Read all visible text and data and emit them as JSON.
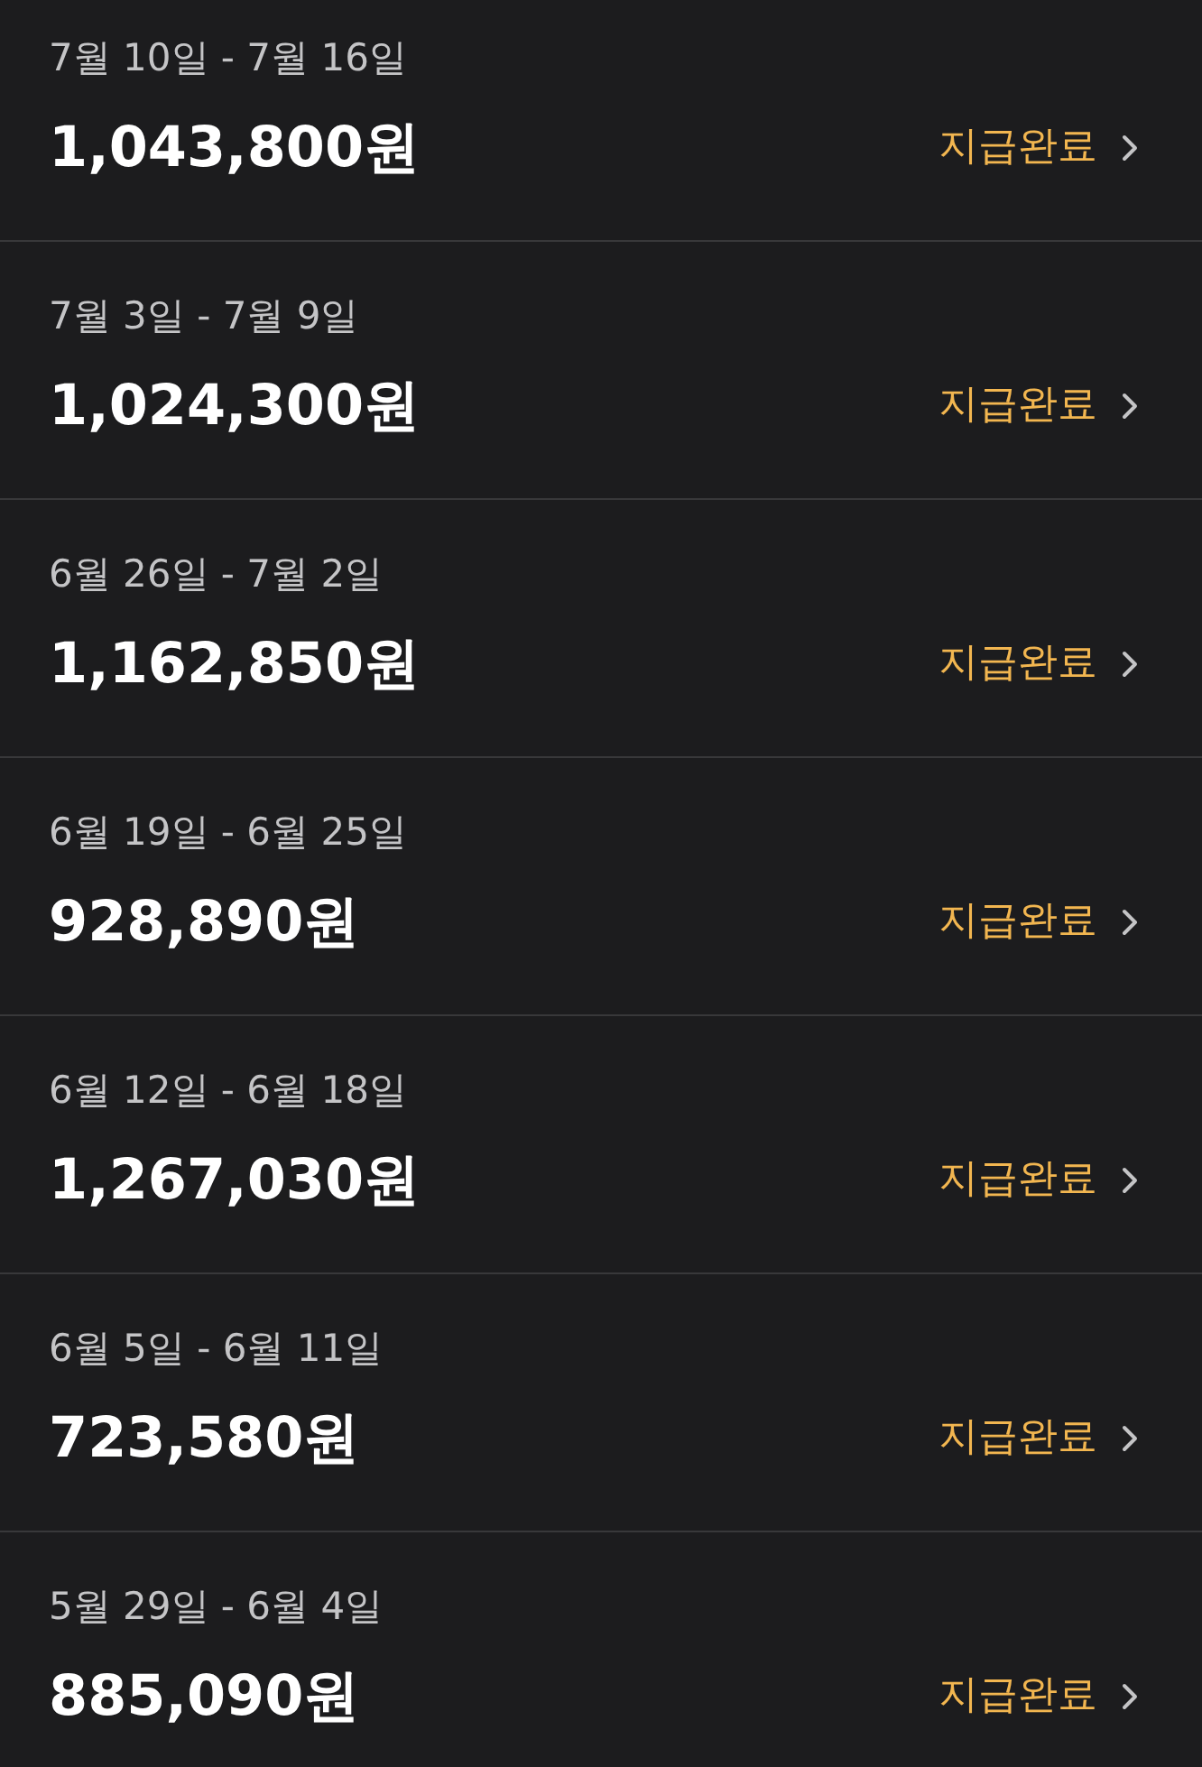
{
  "payouts": [
    {
      "period": "7월 10일 - 7월 16일",
      "amount": "1,043,800원",
      "status": "지급완료"
    },
    {
      "period": "7월 3일 - 7월 9일",
      "amount": "1,024,300원",
      "status": "지급완료"
    },
    {
      "period": "6월 26일 - 7월 2일",
      "amount": "1,162,850원",
      "status": "지급완료"
    },
    {
      "period": "6월 19일 - 6월 25일",
      "amount": "928,890원",
      "status": "지급완료"
    },
    {
      "period": "6월 12일 - 6월 18일",
      "amount": "1,267,030원",
      "status": "지급완료"
    },
    {
      "period": "6월 5일 - 6월 11일",
      "amount": "723,580원",
      "status": "지급완료"
    },
    {
      "period": "5월 29일 - 6월 4일",
      "amount": "885,090원",
      "status": "지급완료"
    }
  ]
}
